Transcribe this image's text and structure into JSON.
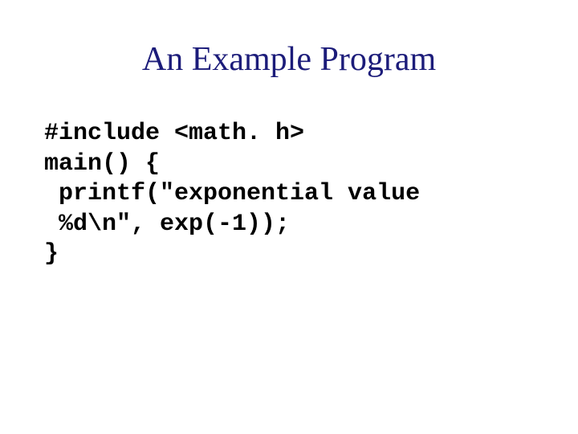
{
  "title": "An Example Program",
  "code": {
    "line1": "#include <math. h>",
    "line2": "main() {",
    "line3": " printf(\"exponential value",
    "line4": " %d\\n\", exp(-1));",
    "line5": "}"
  }
}
